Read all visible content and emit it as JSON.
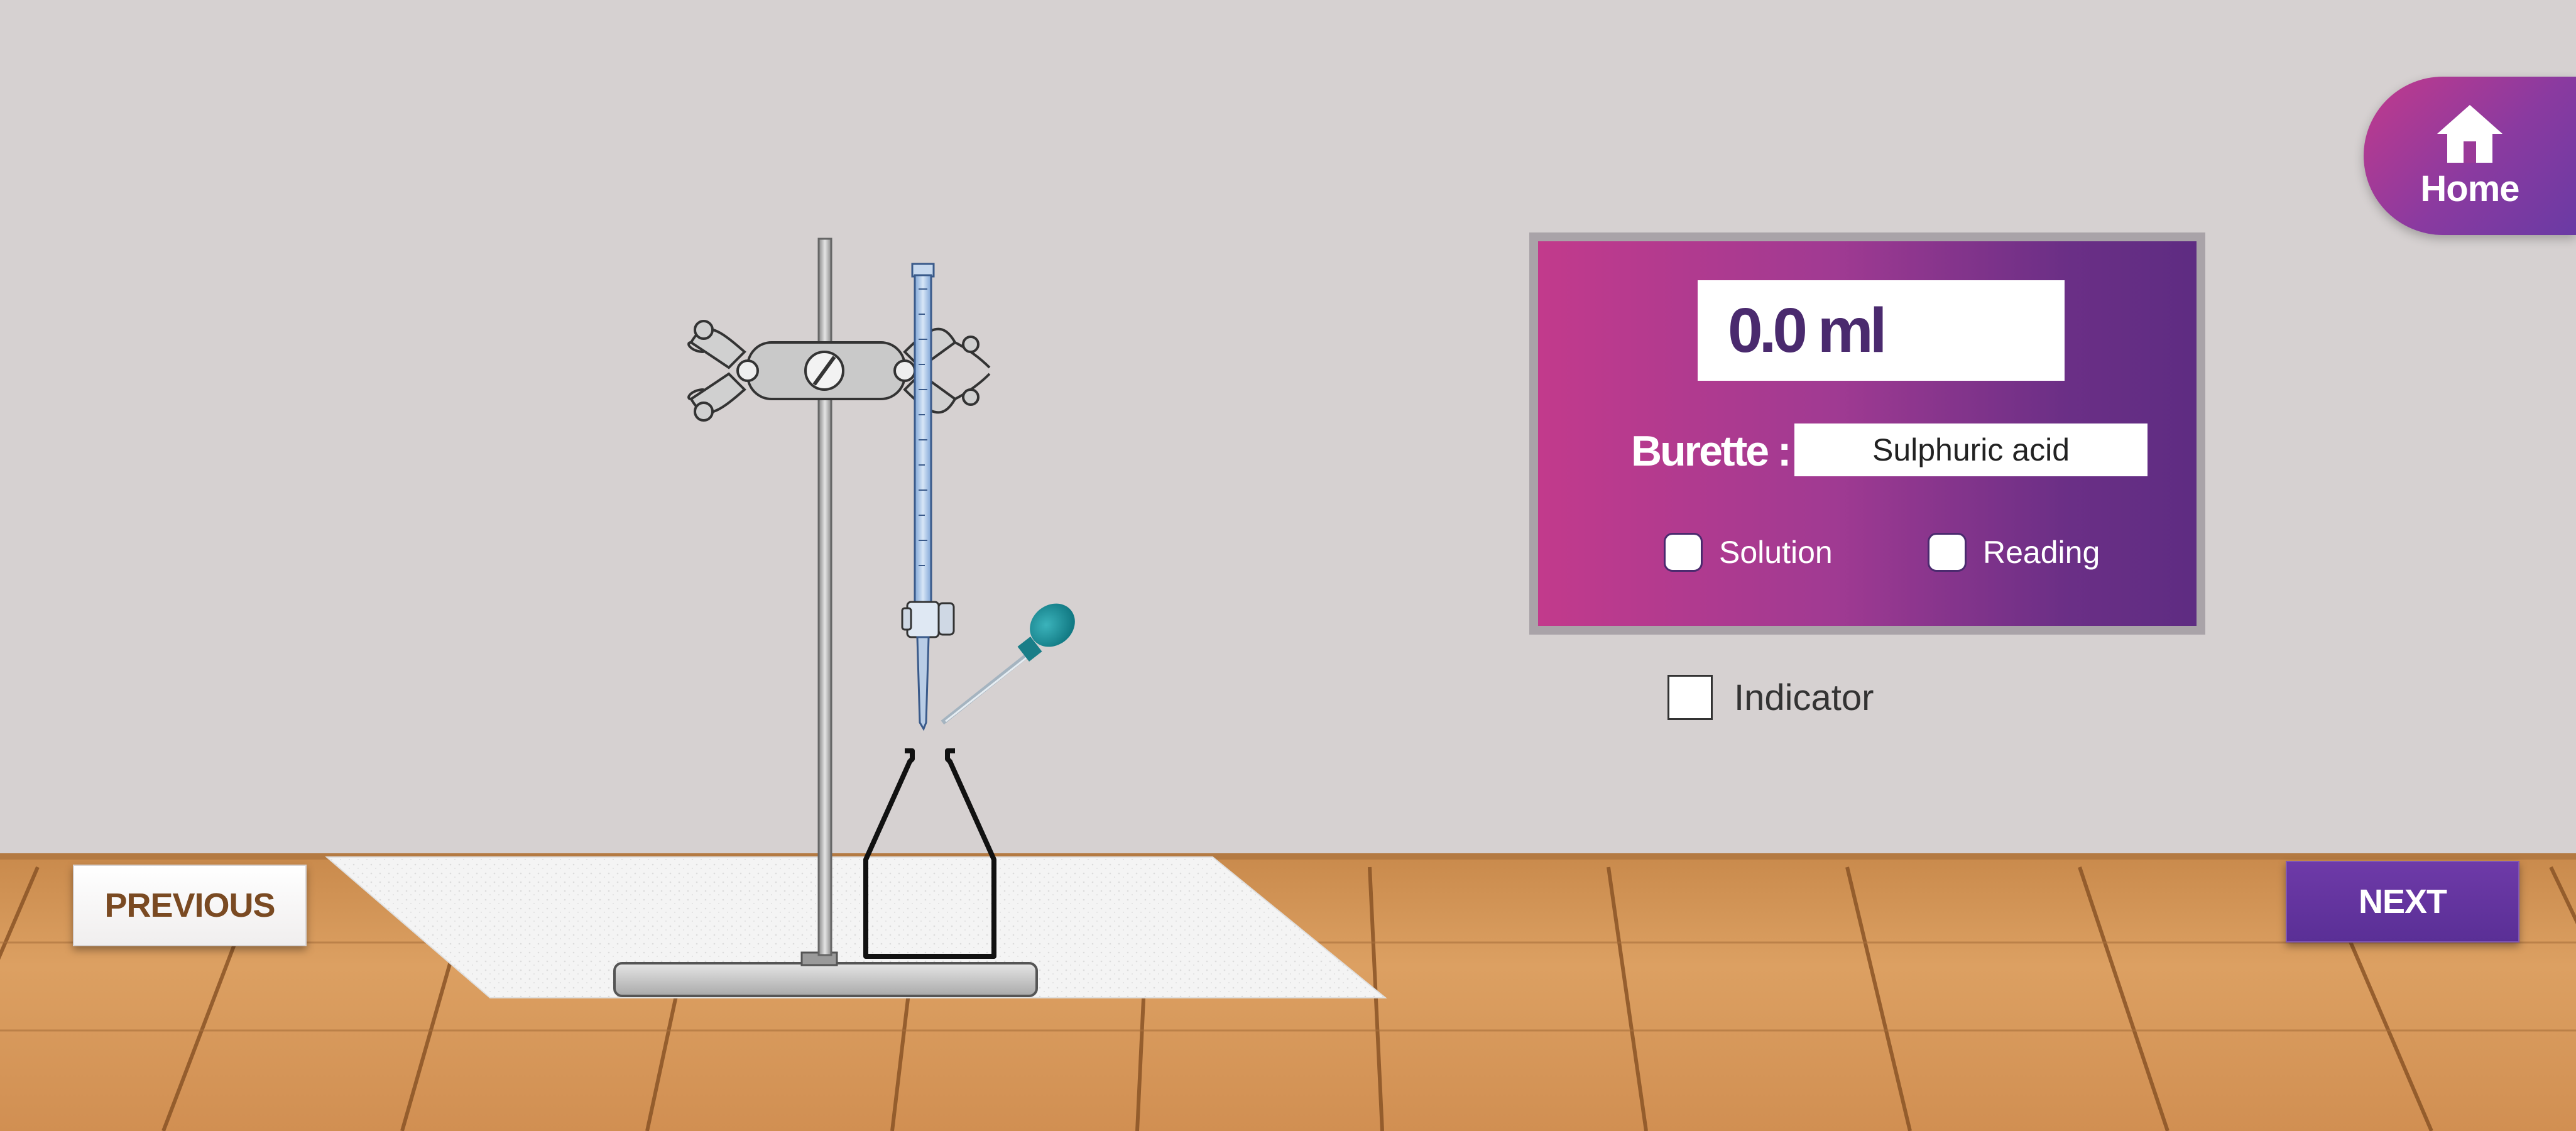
{
  "home": {
    "label": "Home",
    "icon": "home-icon"
  },
  "panel": {
    "reading_value": "0.0 ml",
    "burette_label": "Burette :",
    "burette_value": "Sulphuric acid",
    "checkboxes": [
      {
        "label": "Solution",
        "checked": false
      },
      {
        "label": "Reading",
        "checked": false
      }
    ]
  },
  "indicator": {
    "label": "Indicator",
    "checked": false
  },
  "nav": {
    "previous_label": "PREVIOUS",
    "next_label": "NEXT"
  },
  "colors": {
    "wall": "#d6d1d1",
    "panel_gradient_start": "#c23a8c",
    "panel_gradient_end": "#5e2c82",
    "reading_text": "#4a2a6e",
    "previous_text": "#7a4a22",
    "next_bg": "#5a2f96",
    "floor_wood": "#d99a55",
    "dropper_bulb": "#1a8a94"
  }
}
